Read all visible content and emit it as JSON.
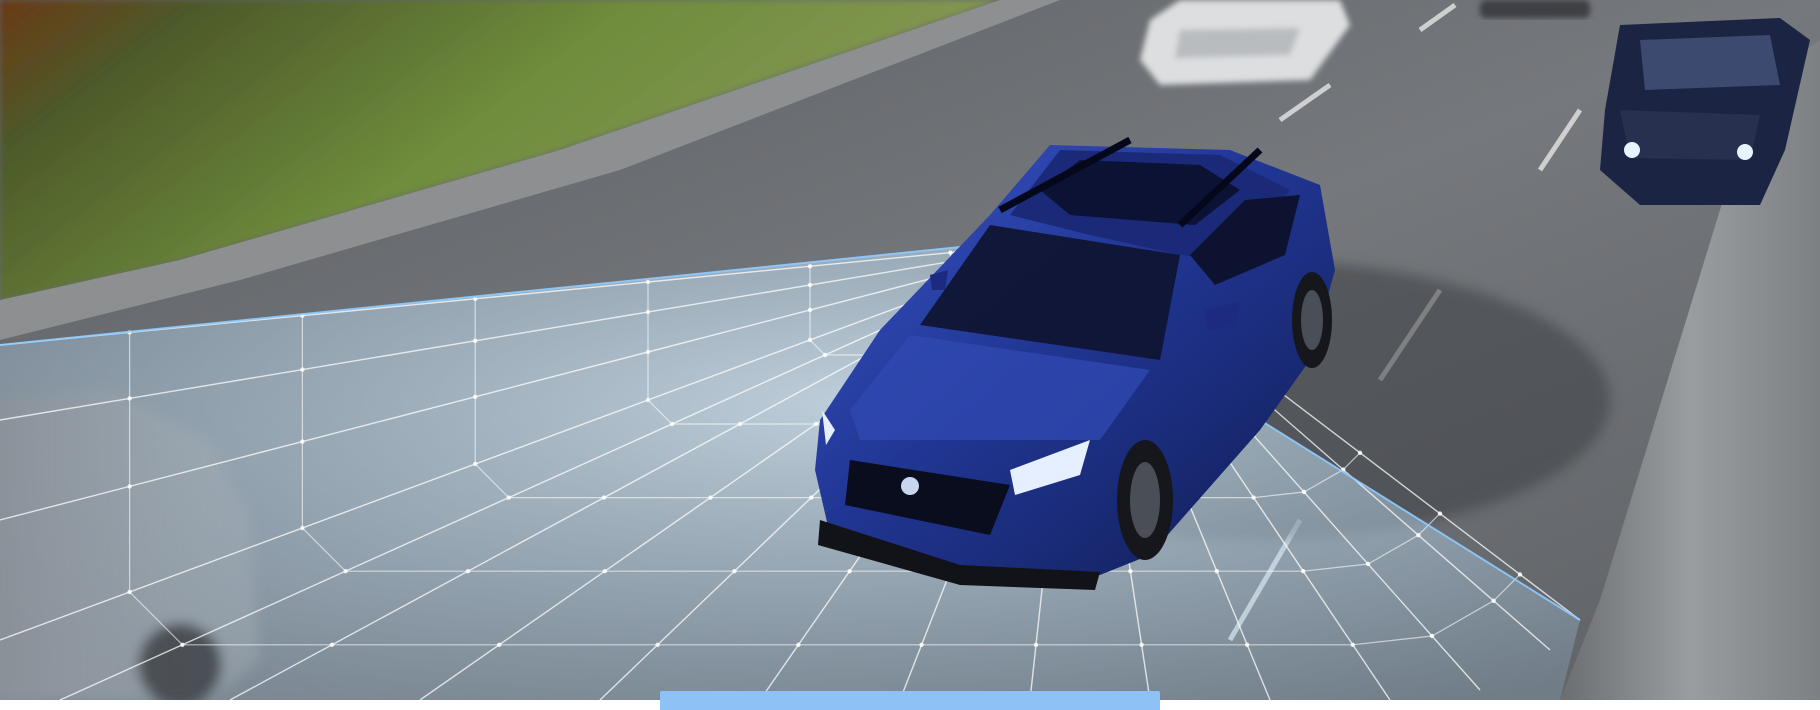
{
  "scene": {
    "subject": "blue-crossover-suv",
    "overlay": "sensor-coverage-grid",
    "colors": {
      "vehicle_body": "#1c2f86",
      "vehicle_highlight": "#3b55c4",
      "road": "#6f7276",
      "road_far": "#55585c",
      "grass": "#5f7d38",
      "grid_line": "#ffffff",
      "grid_edge": "#8ecbff",
      "coverage_fill": "#b9d9ef",
      "barrier": "#8c8f92",
      "tab_indicator": "#8ec2f6"
    }
  }
}
